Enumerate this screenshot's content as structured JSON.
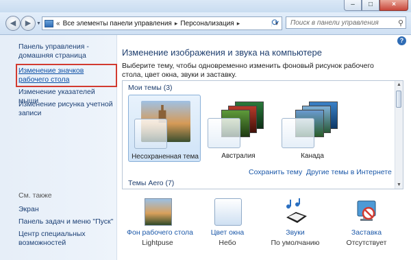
{
  "window": {
    "caption_min": "–",
    "caption_max": "□",
    "caption_close": "×"
  },
  "address": {
    "crumbs": [
      "Все элементы панели управления",
      "Персонализация"
    ],
    "chevron": "«",
    "separator": "▸",
    "dropdown": "▾",
    "search_placeholder": "Поиск в панели управления"
  },
  "icons": {
    "back": "back-arrow-icon",
    "forward": "forward-arrow-icon",
    "refresh": "refresh-icon",
    "search": "magnifier-icon",
    "help": "help-icon",
    "sounds": "sounds-icon",
    "screensaver": "screensaver-icon"
  },
  "sidebar": {
    "items": [
      "Панель управления - домашняя страница",
      "Изменение значков рабочего стола",
      "Изменение указателей мыши",
      "Изменение рисунка учетной записи"
    ],
    "see_also_title": "См. также",
    "see_also": [
      "Экран",
      "Панель задач и меню \"Пуск\"",
      "Центр специальных возможностей"
    ]
  },
  "main": {
    "heading": "Изменение изображения и звука на компьютере",
    "description": "Выберите тему, чтобы одновременно изменить фоновый рисунок рабочего стола, цвет окна, звуки и заставку.",
    "my_themes_title": "Мои темы (3)",
    "aero_themes_title": "Темы Aero (7)",
    "themes": [
      "Несохраненная тема",
      "Австралия",
      "Канада"
    ],
    "save_theme_link": "Сохранить тему",
    "online_themes_link": "Другие темы в Интернете",
    "help_glyph": "?"
  },
  "bottom": [
    {
      "label": "Фон рабочего стола",
      "sub": "Lightpuse"
    },
    {
      "label": "Цвет окна",
      "sub": "Небо"
    },
    {
      "label": "Звуки",
      "sub": "По умолчанию"
    },
    {
      "label": "Заставка",
      "sub": "Отсутствует"
    }
  ],
  "colors": {
    "accent": "#1a57a8",
    "highlight_border": "#d23a30",
    "sidebar_bg": "#e6eef8"
  }
}
